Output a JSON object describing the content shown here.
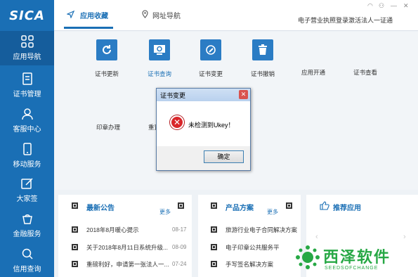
{
  "app": {
    "logo_text": "SICA"
  },
  "sidebar": {
    "items": [
      {
        "label": "应用导航",
        "icon": "grid-icon"
      },
      {
        "label": "证书管理",
        "icon": "document-icon"
      },
      {
        "label": "客服中心",
        "icon": "user-icon"
      },
      {
        "label": "移动服务",
        "icon": "phone-icon"
      },
      {
        "label": "大家签",
        "icon": "sign-icon"
      },
      {
        "label": "金融服务",
        "icon": "finance-icon"
      },
      {
        "label": "信用查询",
        "icon": "search-icon"
      }
    ]
  },
  "header": {
    "tabs": [
      {
        "label": "应用收藏"
      },
      {
        "label": "网址导航"
      }
    ],
    "links": [
      "电子营业执照登录",
      "激活法人一证通"
    ]
  },
  "apps": {
    "row1": [
      {
        "label": "证书更新",
        "icon": "refresh-icon"
      },
      {
        "label": "证书查询",
        "icon": "certificate-search-icon"
      },
      {
        "label": "证书变更",
        "icon": "edit-icon"
      },
      {
        "label": "证书撤销",
        "icon": "trash-icon"
      },
      {
        "label": "应用开通"
      },
      {
        "label": "证书查看"
      }
    ],
    "row2": [
      "印章办理",
      "重置"
    ]
  },
  "dialog": {
    "title": "证书变更",
    "message": "未检测到Ukey！",
    "ok_label": "确定"
  },
  "news": {
    "title": "最新公告",
    "more": "更多",
    "items": [
      {
        "title": "2018年8月暖心提示",
        "date": "08-17"
      },
      {
        "title": "关于2018年8月11日系统升级...",
        "date": "08-09"
      },
      {
        "title": "重磅利好，申请第一张法人一...",
        "date": "07-24"
      }
    ]
  },
  "products": {
    "title": "产品方案",
    "more": "更多",
    "items": [
      "旅游行业电子合同解决方案",
      "电子印章公共服务平",
      "手写签名解决方案"
    ]
  },
  "recommend": {
    "title": "推荐应用"
  },
  "watermark": {
    "text": "西泽软件",
    "sub": "SEEDSOFCHANGE"
  }
}
